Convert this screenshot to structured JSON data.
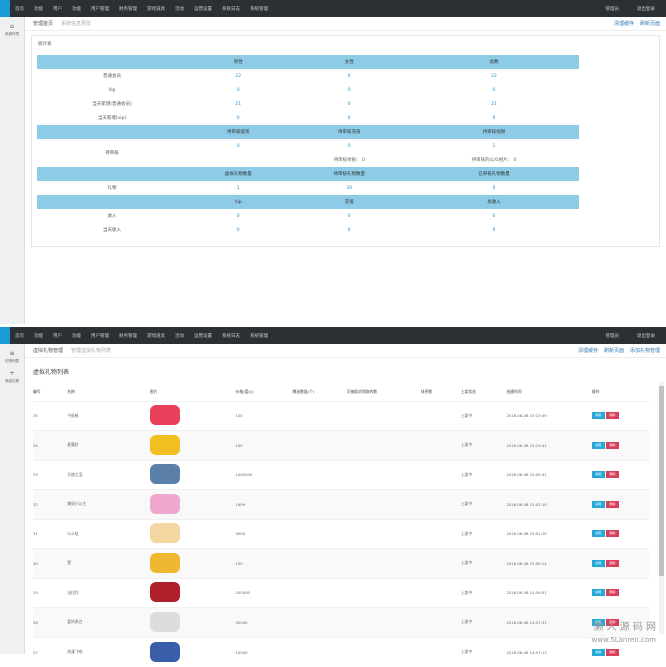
{
  "nav": {
    "items": [
      "首页",
      "功能",
      "用户",
      "功能",
      "用户管理",
      "财务管理",
      "游戏道具",
      "活动",
      "运营设置",
      "系统日志",
      "系统管理"
    ],
    "user": "管理员",
    "logout": "退出登录"
  },
  "panel1": {
    "sidebar": [
      "系统环境"
    ],
    "crumb": "管理首页",
    "crumb_sub": "系统信息预览",
    "rlinks": [
      "清理缓存",
      "刷新页面"
    ],
    "box_title": "统计表",
    "head1": [
      "",
      "男性",
      "女性",
      "总数"
    ],
    "rows1": [
      [
        "普通会员",
        "22",
        "0",
        "22"
      ],
      [
        "Vip",
        "0",
        "0",
        "0"
      ],
      [
        "当天新增(普通会员)",
        "21",
        "0",
        "21"
      ],
      [
        "当天新增(vip)",
        "0",
        "0",
        "0"
      ]
    ],
    "head2": [
      "",
      "待审核提现",
      "待审核充值",
      "待审核视频"
    ],
    "row2": {
      "label": "待审核",
      "vals": [
        "0",
        "0",
        "1"
      ],
      "notes": [
        "待审核举报： 0",
        "待审核的公众相片： 0"
      ]
    },
    "head3": [
      "",
      "虚拟礼物数量",
      "待审核礼物数量",
      "已审核礼物数量"
    ],
    "row3": [
      "礼物",
      "1",
      "30",
      "0"
    ],
    "head4": [
      "",
      "Vip",
      "充值",
      "总收入"
    ],
    "rows4": [
      [
        "收入",
        "0",
        "0",
        "0"
      ],
      [
        "当天收入",
        "0",
        "0",
        "0"
      ]
    ]
  },
  "panel2": {
    "sidebar": [
      "礼物列表",
      "添加礼物"
    ],
    "crumb": "虚拟礼物管理",
    "crumb_sub": "管理虚拟礼物列表",
    "rlinks": [
      "清理缓存",
      "刷新页面",
      "添加礼物管理"
    ],
    "title": "虚拟礼物列表",
    "headers": [
      "编号",
      "名称",
      "图片",
      "价格(爱心)",
      "赠送数量(个)",
      "可被取消领取的数",
      "排序数",
      "上架状态",
      "创建时间",
      "操作"
    ],
    "rows": [
      {
        "id": "35",
        "name": "千纸鹤",
        "price": "100",
        "status": "上架中",
        "time": "2016-06-08 15:13:49",
        "color": "#e8405a"
      },
      {
        "id": "34",
        "name": "麦霸秒",
        "price": "100",
        "status": "上架中",
        "time": "2016-06-08 15:13:41",
        "color": "#f0c020"
      },
      {
        "id": "33",
        "name": "天使之泪",
        "price": "1000000",
        "status": "上架中",
        "time": "2016-06-08 15:05:41",
        "color": "#5a7fa8"
      },
      {
        "id": "32",
        "name": "美丽小公主",
        "price": "1999",
        "status": "上架中",
        "time": "2016-06-08 15:02:10",
        "color": "#f0a8d0"
      },
      {
        "id": "31",
        "name": "么么哒",
        "price": "5000",
        "status": "上架中",
        "time": "2016-06-08 15:01:20",
        "color": "#f2d7a0"
      },
      {
        "id": "30",
        "name": "赞",
        "price": "100",
        "status": "上架中",
        "time": "2016-06-08 15:00:14",
        "color": "#f0b830"
      },
      {
        "id": "29",
        "name": "法拉利",
        "price": "200000",
        "status": "上架中",
        "time": "2016-06-08 14:59:51",
        "color": "#b0202a"
      },
      {
        "id": "28",
        "name": "爱的表白",
        "price": "50000",
        "status": "上架中",
        "time": "2016-06-08 14:57:31",
        "color": "#dddddd"
      },
      {
        "id": "27",
        "name": "浪漫飞吻",
        "price": "10000",
        "status": "上架中",
        "time": "2016-06-08 14:57:13",
        "color": "#3a5ea8"
      }
    ],
    "edit": "编辑",
    "del": "删除"
  },
  "watermark": {
    "line1": "懒 人 源 码 网",
    "line2": "www.5Lanren.com"
  }
}
